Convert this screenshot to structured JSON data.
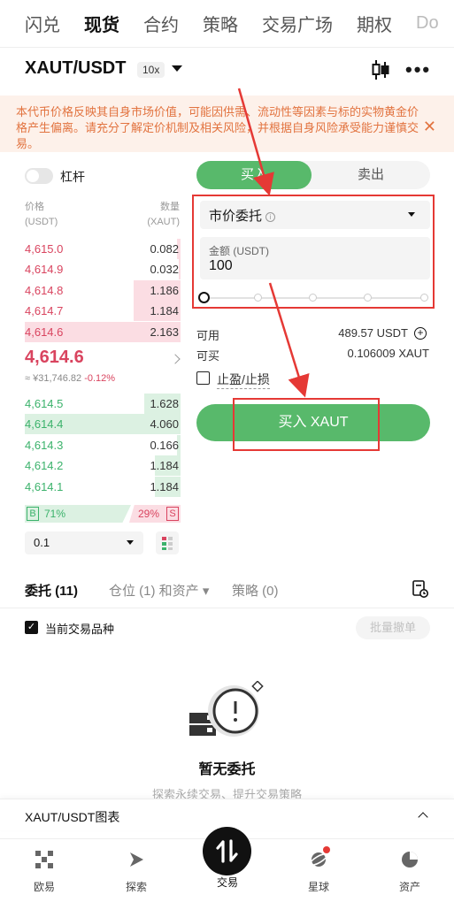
{
  "top_tabs": [
    "闪兑",
    "现货",
    "合约",
    "策略",
    "交易广场",
    "期权",
    "Do"
  ],
  "pair": {
    "symbol": "XAUT/USDT",
    "leverage": "10x"
  },
  "warning": "本代币价格反映其自身市场价值，可能因供需、流动性等因素与标的实物黄金价格产生偏离。请充分了解定价机制及相关风险，并根据自身风险承受能力谨慎交易。",
  "margin_label": "杠杆",
  "orderbook": {
    "price_header": "价格",
    "price_unit": "(USDT)",
    "qty_header": "数量",
    "qty_unit": "(XAUT)",
    "asks": [
      {
        "price": "4,615.0",
        "qty": "0.082",
        "depth": 0.04
      },
      {
        "price": "4,614.9",
        "qty": "0.032",
        "depth": 0.02
      },
      {
        "price": "4,614.8",
        "qty": "1.186",
        "depth": 0.55
      },
      {
        "price": "4,614.7",
        "qty": "1.184",
        "depth": 0.55
      },
      {
        "price": "4,614.6",
        "qty": "2.163",
        "depth": 1.0
      }
    ],
    "last_price": "4,614.6",
    "converted": "≈ ¥31,746.82",
    "change": "-0.12%",
    "bids": [
      {
        "price": "4,614.5",
        "qty": "1.628",
        "depth": 0.42
      },
      {
        "price": "4,614.4",
        "qty": "4.060",
        "depth": 1.0
      },
      {
        "price": "4,614.3",
        "qty": "0.166",
        "depth": 0.04
      },
      {
        "price": "4,614.2",
        "qty": "1.184",
        "depth": 0.3
      },
      {
        "price": "4,614.1",
        "qty": "1.184",
        "depth": 0.3
      }
    ],
    "buy_ratio_tag": "B",
    "buy_ratio": "71%",
    "sell_ratio": "29%",
    "sell_ratio_tag": "S",
    "depth_step": "0.1"
  },
  "form": {
    "buy_tab": "买入",
    "sell_tab": "卖出",
    "order_type": "市价委托",
    "amount_label": "金额 (USDT)",
    "amount_value": "100",
    "available_label": "可用",
    "available_value": "489.57 USDT",
    "can_buy_label": "可买",
    "can_buy_value": "0.106009 XAUT",
    "tpsl_label": "止盈/止损",
    "submit": "买入 XAUT"
  },
  "orders": {
    "tab_open": "委托 (11)",
    "tab_positions": "仓位 (1) 和资产",
    "tab_strategy": "策略 (0)",
    "current_only": "当前交易品种",
    "batch_cancel": "批量撤单",
    "empty_title": "暂无委托",
    "empty_sub": "探索永续交易、提升交易策略"
  },
  "chart_bar": "XAUT/USDT图表",
  "bottom_nav": [
    "欧易",
    "探索",
    "交易",
    "星球",
    "资产"
  ],
  "colors": {
    "buy": "#58b96b",
    "sell": "#d9445f",
    "accent_red": "#e53935",
    "warning": "#e2733f"
  }
}
